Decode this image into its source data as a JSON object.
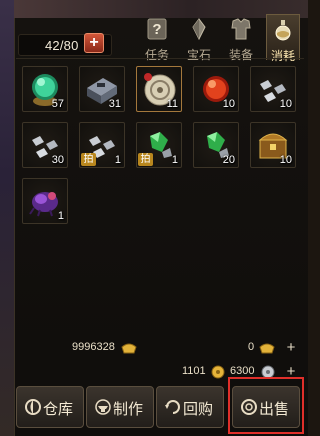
{
  "header": {
    "capacity": "42/80",
    "expand_label": "+"
  },
  "tabs": [
    {
      "label": "任务",
      "icon": "question-scroll-icon"
    },
    {
      "label": "宝石",
      "icon": "crystal-icon"
    },
    {
      "label": "装备",
      "icon": "armor-icon"
    },
    {
      "label": "消耗",
      "icon": "potion-icon",
      "active": true
    }
  ],
  "inventory": [
    {
      "icon": "green-orb-icon",
      "qty": "57"
    },
    {
      "icon": "toolkit-box-icon",
      "qty": "31"
    },
    {
      "icon": "jade-disc-icon",
      "qty": "11"
    },
    {
      "icon": "red-orb-icon",
      "qty": "10"
    },
    {
      "icon": "silver-ore-icon",
      "qty": "10"
    },
    {
      "icon": "silver-ore-icon",
      "qty": "30"
    },
    {
      "icon": "silver-ore-icon",
      "qty": "1",
      "tag": "拍"
    },
    {
      "icon": "green-gem-icon",
      "qty": "1",
      "tag": "拍"
    },
    {
      "icon": "green-gem-icon",
      "qty": "20"
    },
    {
      "icon": "treasure-chest-icon",
      "qty": "10"
    },
    {
      "icon": "purple-creature-icon",
      "qty": "1"
    }
  ],
  "currency": {
    "silver": "9996328",
    "bound_gold": "0",
    "gold": "1101",
    "coupon": "6300"
  },
  "buttons": {
    "warehouse": "仓库",
    "craft": "制作",
    "buyback": "回购",
    "sell": "出售"
  },
  "colors": {
    "accent_red": "#e02f2a",
    "tag_gold": "#b9871e",
    "text": "#e8dcc4"
  }
}
